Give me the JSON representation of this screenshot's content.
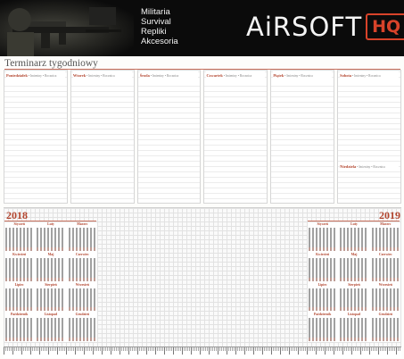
{
  "banner": {
    "tags": [
      "Militaria",
      "Survival",
      "Repliki",
      "Akcesoria"
    ],
    "logo_word": "AiRSOFT",
    "logo_mark": "HQ",
    "photo_icon": "soldier-rifle-photo",
    "accent": "#d8432a"
  },
  "planner": {
    "title": "Terminarz  tygodniowy",
    "days": [
      {
        "name": "Poniedziałek",
        "namedays": "• Imieniny • Rocznica"
      },
      {
        "name": "Wtorek",
        "namedays": "• Imieniny • Rocznica"
      },
      {
        "name": "Środa",
        "namedays": "• Imieniny • Rocznica"
      },
      {
        "name": "Czwartek",
        "namedays": "• Imieniny • Rocznica"
      },
      {
        "name": "Piątek",
        "namedays": "• Imieniny • Rocznica"
      },
      {
        "name": "Sobota",
        "namedays": "• Imieniny • Rocznica"
      }
    ],
    "sunday": {
      "name": "Niedziela",
      "namedays": "• Imieniny • Rocznica"
    },
    "accent": "#b2452e"
  },
  "calendars": {
    "left_year": "2018",
    "right_year": "2019",
    "months": [
      "Styczeń",
      "Luty",
      "Marzec",
      "Kwiecień",
      "Maj",
      "Czerwiec",
      "Lipiec",
      "Sierpień",
      "Wrzesień",
      "Październik",
      "Listopad",
      "Grudzień"
    ]
  }
}
